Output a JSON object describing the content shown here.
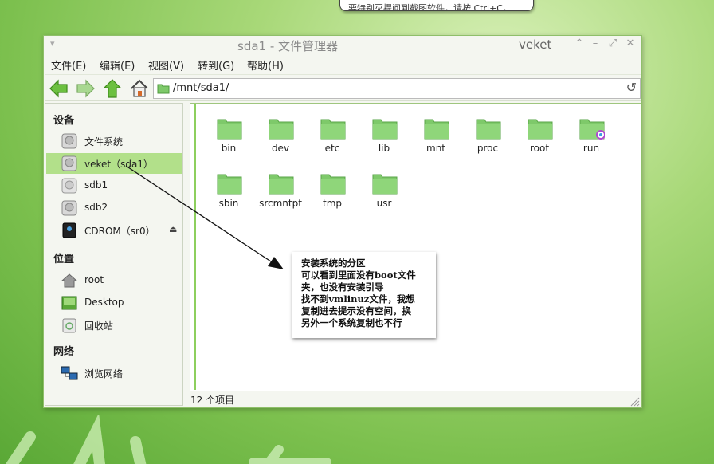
{
  "popup": {
    "text": "要特别灭提问到截图软件，请按 Ctrl+C。"
  },
  "window": {
    "menu_glyph": "▾",
    "title": "sda1 - 文件管理器",
    "user": "veket",
    "controls": {
      "shade": "⌃",
      "minimize": "–",
      "maximize": "⤢",
      "close": "✕"
    }
  },
  "menubar": [
    {
      "label": "文件(E)"
    },
    {
      "label": "编辑(E)"
    },
    {
      "label": "视图(V)"
    },
    {
      "label": "转到(G)"
    },
    {
      "label": "帮助(H)"
    }
  ],
  "toolbar": {
    "back_icon": "back-arrow-icon",
    "forward_icon": "forward-arrow-icon",
    "up_icon": "up-arrow-icon",
    "home_icon": "home-icon",
    "path": "/mnt/sda1/",
    "refresh": "↺"
  },
  "sidebar": {
    "devices_title": "设备",
    "devices": [
      {
        "label": "文件系统",
        "icon": "drive-icon"
      },
      {
        "label": "veket（sda1）",
        "icon": "drive-icon",
        "selected": true
      },
      {
        "label": "sdb1",
        "icon": "drive-icon"
      },
      {
        "label": "sdb2",
        "icon": "drive-icon"
      },
      {
        "label": "CDROM（sr0）",
        "icon": "cdrom-icon",
        "eject": "⏏"
      }
    ],
    "places_title": "位置",
    "places": [
      {
        "label": "root",
        "icon": "home-icon"
      },
      {
        "label": "Desktop",
        "icon": "desktop-icon"
      },
      {
        "label": "回收站",
        "icon": "trash-icon"
      }
    ],
    "network_title": "网络",
    "network": [
      {
        "label": "浏览网络",
        "icon": "network-icon"
      }
    ]
  },
  "folders": [
    "bin",
    "dev",
    "etc",
    "lib",
    "mnt",
    "proc",
    "root",
    "run",
    "sbin",
    "srcmntpt",
    "tmp",
    "usr"
  ],
  "status": {
    "count": "12 个项目"
  },
  "note": {
    "lines": [
      "安装系统的分区",
      "可以看到里面没有boot文件",
      "夹，也没有安装引导",
      "找不到vmlinuz文件，我想",
      "复制进去提示没有空间，换",
      "另外一个系统复制也不行"
    ]
  },
  "colors": {
    "accent": "#8dcf5e",
    "selection": "#b2e08a",
    "folder": "#7ec96a"
  }
}
